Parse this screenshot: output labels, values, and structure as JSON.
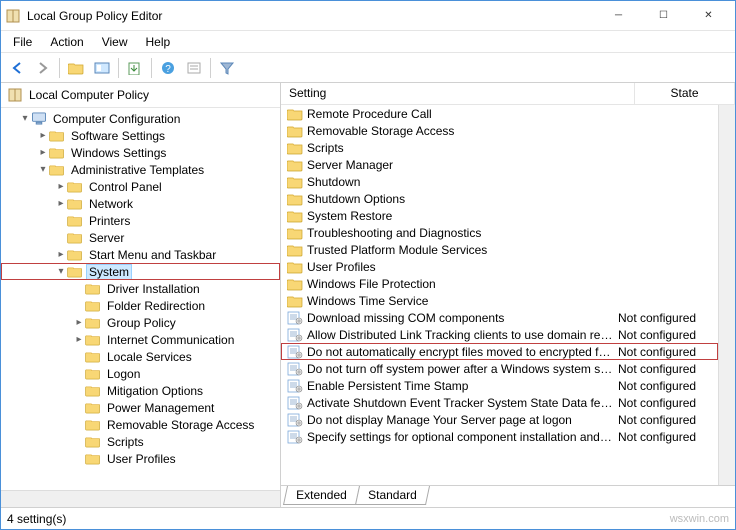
{
  "title": "Local Group Policy Editor",
  "menus": [
    "File",
    "Action",
    "View",
    "Help"
  ],
  "tree_root": "Local Computer Policy",
  "tree": [
    {
      "d": 0,
      "exp": "▾",
      "icon": "computer",
      "label": "Computer Configuration"
    },
    {
      "d": 1,
      "exp": "▸",
      "icon": "folder",
      "label": "Software Settings"
    },
    {
      "d": 1,
      "exp": "▸",
      "icon": "folder",
      "label": "Windows Settings"
    },
    {
      "d": 1,
      "exp": "▾",
      "icon": "folder",
      "label": "Administrative Templates"
    },
    {
      "d": 2,
      "exp": "▸",
      "icon": "folder",
      "label": "Control Panel"
    },
    {
      "d": 2,
      "exp": "▸",
      "icon": "folder",
      "label": "Network"
    },
    {
      "d": 2,
      "exp": "",
      "icon": "folder",
      "label": "Printers"
    },
    {
      "d": 2,
      "exp": "",
      "icon": "folder",
      "label": "Server"
    },
    {
      "d": 2,
      "exp": "▸",
      "icon": "folder",
      "label": "Start Menu and Taskbar"
    },
    {
      "d": 2,
      "exp": "▾",
      "icon": "folder",
      "label": "System",
      "sel": true,
      "hl": true
    },
    {
      "d": 3,
      "exp": "",
      "icon": "folder",
      "label": "Driver Installation"
    },
    {
      "d": 3,
      "exp": "",
      "icon": "folder",
      "label": "Folder Redirection"
    },
    {
      "d": 3,
      "exp": "▸",
      "icon": "folder",
      "label": "Group Policy"
    },
    {
      "d": 3,
      "exp": "▸",
      "icon": "folder",
      "label": "Internet Communication"
    },
    {
      "d": 3,
      "exp": "",
      "icon": "folder",
      "label": "Locale Services"
    },
    {
      "d": 3,
      "exp": "",
      "icon": "folder",
      "label": "Logon"
    },
    {
      "d": 3,
      "exp": "",
      "icon": "folder",
      "label": "Mitigation Options"
    },
    {
      "d": 3,
      "exp": "",
      "icon": "folder",
      "label": "Power Management"
    },
    {
      "d": 3,
      "exp": "",
      "icon": "folder",
      "label": "Removable Storage Access"
    },
    {
      "d": 3,
      "exp": "",
      "icon": "folder",
      "label": "Scripts"
    },
    {
      "d": 3,
      "exp": "",
      "icon": "folder",
      "label": "User Profiles"
    }
  ],
  "columns": {
    "setting": "Setting",
    "state": "State"
  },
  "list": [
    {
      "icon": "folder",
      "text": "Remote Procedure Call",
      "state": ""
    },
    {
      "icon": "folder",
      "text": "Removable Storage Access",
      "state": ""
    },
    {
      "icon": "folder",
      "text": "Scripts",
      "state": ""
    },
    {
      "icon": "folder",
      "text": "Server Manager",
      "state": ""
    },
    {
      "icon": "folder",
      "text": "Shutdown",
      "state": ""
    },
    {
      "icon": "folder",
      "text": "Shutdown Options",
      "state": ""
    },
    {
      "icon": "folder",
      "text": "System Restore",
      "state": ""
    },
    {
      "icon": "folder",
      "text": "Troubleshooting and Diagnostics",
      "state": ""
    },
    {
      "icon": "folder",
      "text": "Trusted Platform Module Services",
      "state": ""
    },
    {
      "icon": "folder",
      "text": "User Profiles",
      "state": ""
    },
    {
      "icon": "folder",
      "text": "Windows File Protection",
      "state": ""
    },
    {
      "icon": "folder",
      "text": "Windows Time Service",
      "state": ""
    },
    {
      "icon": "policy",
      "text": "Download missing COM components",
      "state": "Not configured"
    },
    {
      "icon": "policy",
      "text": "Allow Distributed Link Tracking clients to use domain resour...",
      "state": "Not configured"
    },
    {
      "icon": "policy",
      "text": "Do not automatically encrypt files moved to encrypted fold...",
      "state": "Not configured",
      "hl": true
    },
    {
      "icon": "policy",
      "text": "Do not turn off system power after a Windows system shutd...",
      "state": "Not configured"
    },
    {
      "icon": "policy",
      "text": "Enable Persistent Time Stamp",
      "state": "Not configured"
    },
    {
      "icon": "policy",
      "text": "Activate Shutdown Event Tracker System State Data feature",
      "state": "Not configured"
    },
    {
      "icon": "policy",
      "text": "Do not display Manage Your Server page at logon",
      "state": "Not configured"
    },
    {
      "icon": "policy",
      "text": "Specify settings for optional component installation and co...",
      "state": "Not configured"
    }
  ],
  "tabs": [
    "Extended",
    "Standard"
  ],
  "active_tab": 1,
  "status": "4 setting(s)",
  "watermark": "wsxwin.com"
}
